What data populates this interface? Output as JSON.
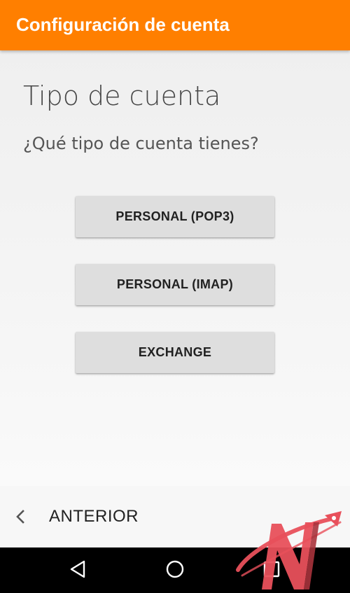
{
  "app_bar": {
    "title": "Configuración de cuenta",
    "color": "#ff7f00"
  },
  "main": {
    "heading": "Tipo de cuenta",
    "question": "¿Qué tipo de cuenta tienes?",
    "buttons": [
      {
        "label": "PERSONAL (POP3)"
      },
      {
        "label": "PERSONAL (IMAP)"
      },
      {
        "label": "EXCHANGE"
      }
    ]
  },
  "footer": {
    "back_label": "ANTERIOR",
    "back_icon": "chevron-left-icon"
  },
  "nav_bar": {
    "icons": [
      "back-triangle-icon",
      "home-circle-icon",
      "recents-square-icon"
    ]
  },
  "watermark": {
    "logo": "N-rocket-logo",
    "color": "#e8505b"
  }
}
